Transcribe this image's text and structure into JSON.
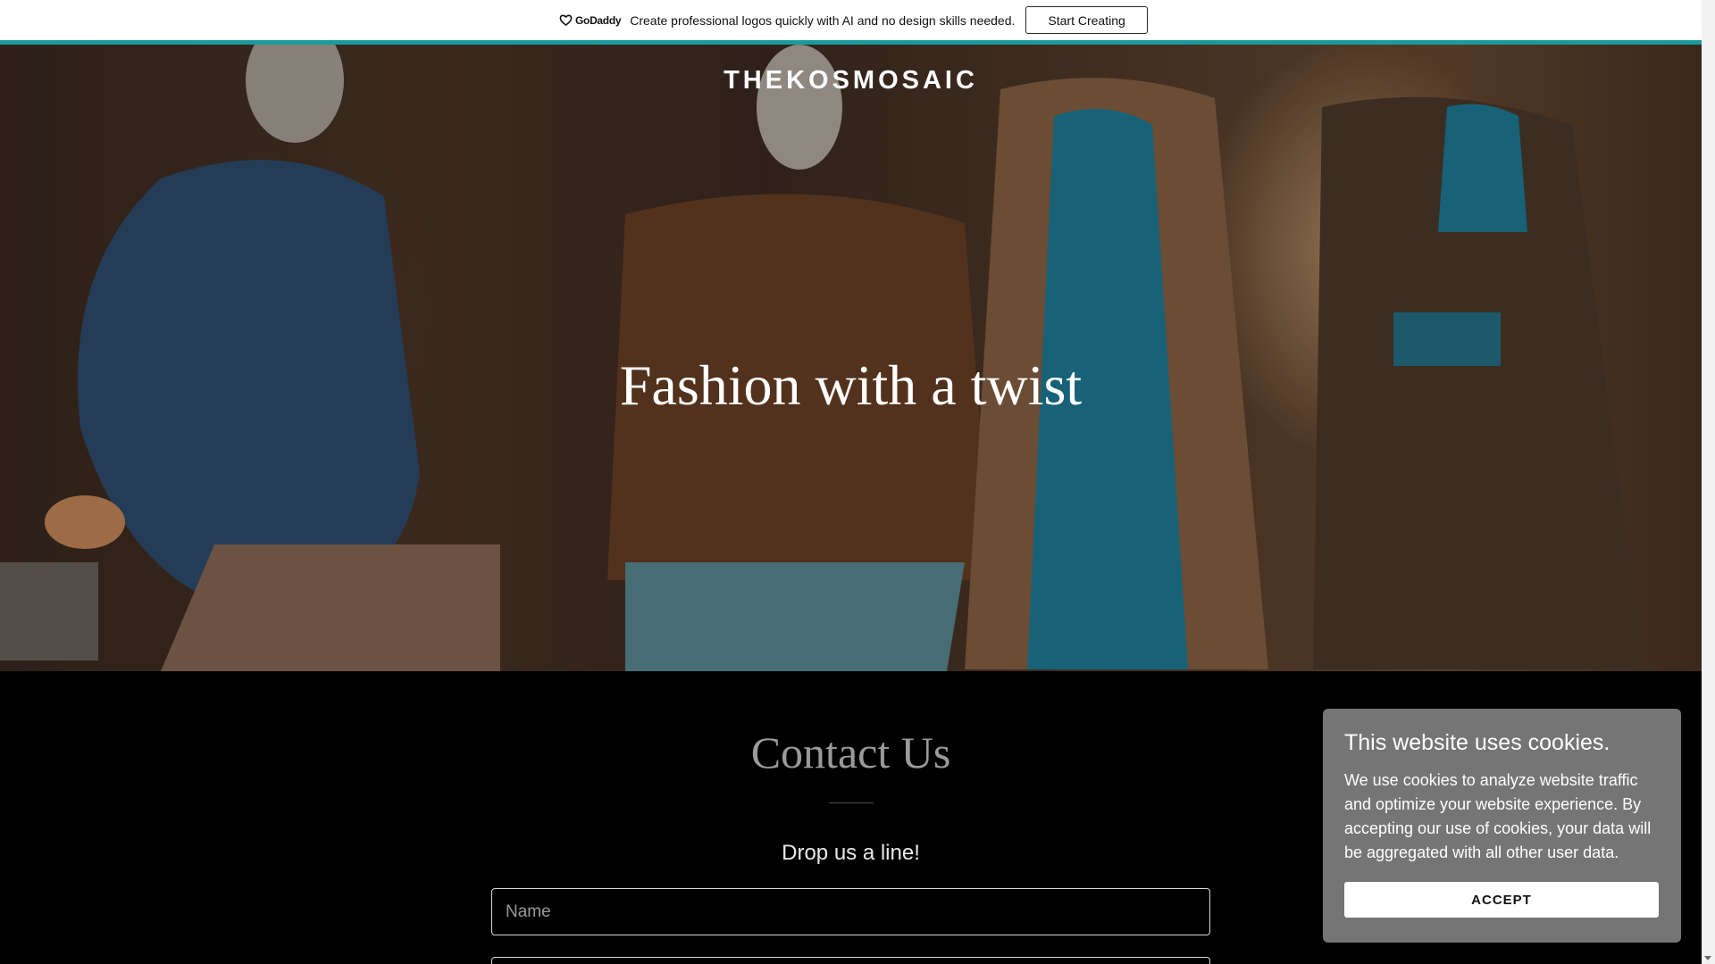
{
  "promo": {
    "logo_text": "GoDaddy",
    "message": "Create professional logos quickly with AI and no design skills needed.",
    "button_label": "Start Creating",
    "accent_color": "#1a9a9a"
  },
  "hero": {
    "brand": "THEKOSMOSAIC",
    "heading": "Fashion with a twist"
  },
  "contact": {
    "title": "Contact Us",
    "subtitle": "Drop us a line!",
    "name_placeholder": "Name",
    "email_placeholder": ""
  },
  "cookie": {
    "title": "This website uses cookies.",
    "body": "We use cookies to analyze website traffic and optimize your website experience. By accepting our use of cookies, your data will be aggregated with all other user data.",
    "accept_label": "ACCEPT"
  },
  "icons": {
    "godaddy_logo": "godaddy-logo-icon",
    "scroll_down": "scroll-down-arrow-icon"
  }
}
